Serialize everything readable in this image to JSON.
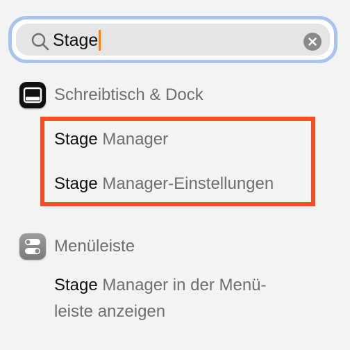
{
  "search": {
    "value": "Stage"
  },
  "sections": [
    {
      "title": "Schreibtisch & Dock",
      "icon": "desktop-dock-icon",
      "results": [
        {
          "match": "Stage",
          "rest": " Manager"
        },
        {
          "match": "Stage",
          "rest": " Manager-Einstellungen"
        }
      ]
    },
    {
      "title": "Menüleiste",
      "icon": "menubar-toggle-icon",
      "results": [
        {
          "match": "Stage",
          "rest": " Manager in der Menü-",
          "rest2": "leiste anzeigen"
        }
      ]
    }
  ],
  "colors": {
    "highlight": "#f04e23",
    "caret": "#f08321",
    "focus_ring": "#a9c3ee",
    "match_text": "#111111",
    "secondary_text": "#6e6e6e"
  }
}
